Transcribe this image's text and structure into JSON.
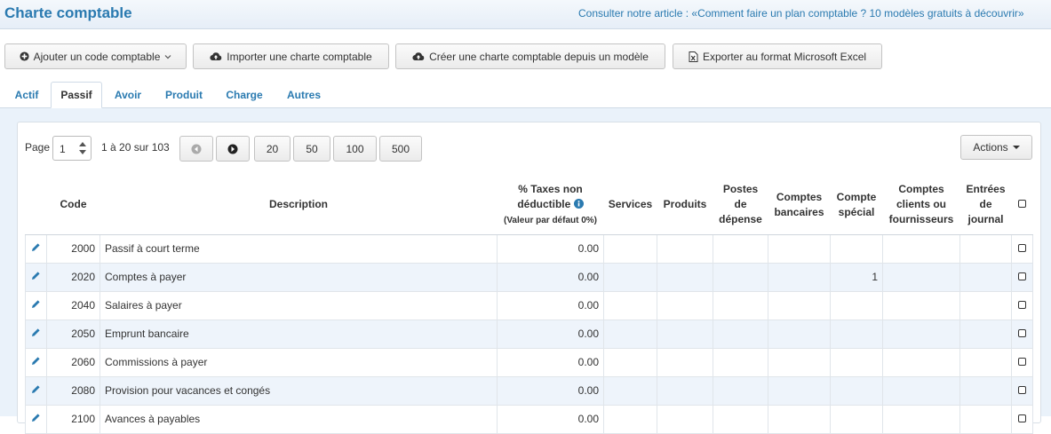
{
  "header": {
    "title": "Charte comptable",
    "article_link": "Consulter notre article : «Comment faire un plan comptable ? 10 modèles gratuits à découvrir» "
  },
  "toolbar": {
    "add_label": "Ajouter un code comptable",
    "import_label": "Importer une charte comptable",
    "create_label": "Créer une charte comptable depuis un modèle",
    "export_label": "Exporter au format Microsoft Excel"
  },
  "tabs": [
    {
      "label": "Actif"
    },
    {
      "label": "Passif"
    },
    {
      "label": "Avoir"
    },
    {
      "label": "Produit"
    },
    {
      "label": "Charge"
    },
    {
      "label": "Autres"
    }
  ],
  "active_tab": "Passif",
  "pagination": {
    "page_label": "Page",
    "page_value": "1",
    "range_text": "1 à 20 sur 103",
    "page_sizes": [
      "20",
      "50",
      "100",
      "500"
    ],
    "actions_label": "Actions"
  },
  "table": {
    "columns": {
      "code": "Code",
      "description": "Description",
      "taxes_line1": "% Taxes non",
      "taxes_line2": "déductible",
      "taxes_sub": "(Valeur par défaut 0%)",
      "services": "Services",
      "produits": "Produits",
      "postes_l1": "Postes",
      "postes_l2": "de",
      "postes_l3": "dépense",
      "bancaires_l1": "Comptes",
      "bancaires_l2": "bancaires",
      "special_l1": "Compte",
      "special_l2": "spécial",
      "clients_l1": "Comptes",
      "clients_l2": "clients ou",
      "clients_l3": "fournisseurs",
      "entrees_l1": "Entrées",
      "entrees_l2": "de",
      "entrees_l3": "journal"
    },
    "rows": [
      {
        "code": "2000",
        "description": "Passif à court terme",
        "taxes": "0.00",
        "special": ""
      },
      {
        "code": "2020",
        "description": "Comptes à payer",
        "taxes": "0.00",
        "special": "1"
      },
      {
        "code": "2040",
        "description": "Salaires à payer",
        "taxes": "0.00",
        "special": ""
      },
      {
        "code": "2050",
        "description": "Emprunt bancaire",
        "taxes": "0.00",
        "special": ""
      },
      {
        "code": "2060",
        "description": "Commissions à payer",
        "taxes": "0.00",
        "special": ""
      },
      {
        "code": "2080",
        "description": "Provision pour vacances et congés",
        "taxes": "0.00",
        "special": ""
      },
      {
        "code": "2100",
        "description": "Avances à payables",
        "taxes": "0.00",
        "special": ""
      }
    ]
  },
  "colors": {
    "accent": "#2a7ab0",
    "row_alt": "#eef4fb",
    "content_bg": "#eaf2fa"
  }
}
